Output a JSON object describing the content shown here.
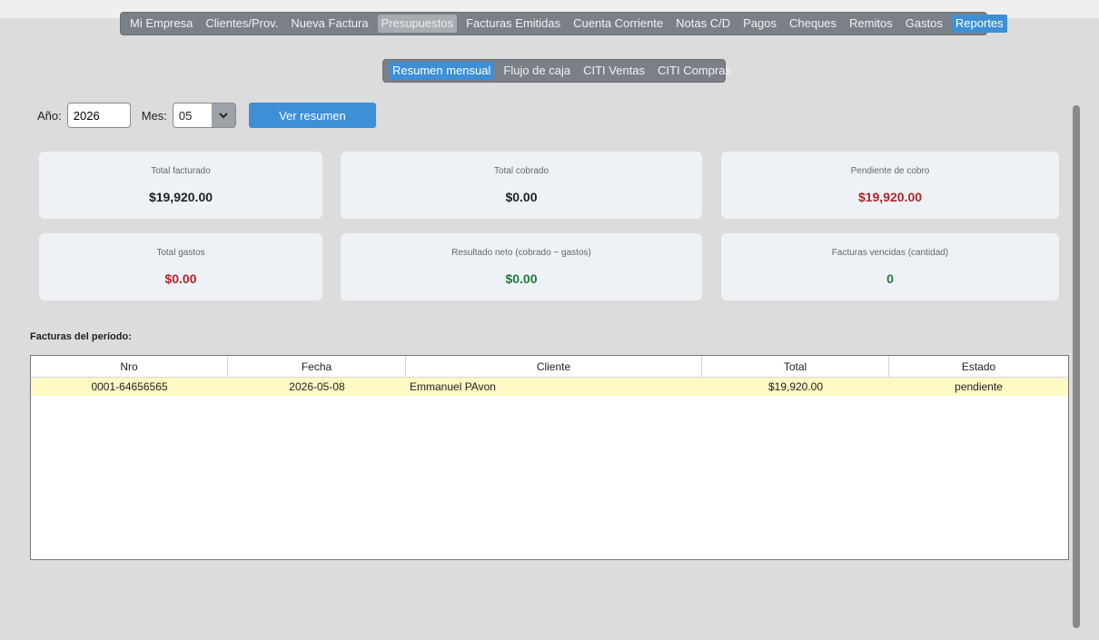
{
  "nav": {
    "tabs": [
      "Mi Empresa",
      "Clientes/Prov.",
      "Nueva Factura",
      "Presupuestos",
      "Facturas Emitidas",
      "Cuenta Corriente",
      "Notas C/D",
      "Pagos",
      "Cheques",
      "Remitos",
      "Gastos",
      "Reportes"
    ],
    "highlighted": "Presupuestos",
    "active": "Reportes"
  },
  "subnav": {
    "tabs": [
      "Resumen mensual",
      "Flujo de caja",
      "CITI Ventas",
      "CITI Compras"
    ],
    "active": "Resumen mensual"
  },
  "filters": {
    "year_label": "Año:",
    "year_value": "2026",
    "month_label": "Mes:",
    "month_value": "05",
    "submit_label": "Ver resumen"
  },
  "summary": {
    "total_facturado": {
      "label": "Total facturado",
      "value": "$19,920.00"
    },
    "total_cobrado": {
      "label": "Total cobrado",
      "value": "$0.00"
    },
    "pendiente_cobro": {
      "label": "Pendiente de cobro",
      "value": "$19,920.00"
    },
    "total_gastos": {
      "label": "Total gastos",
      "value": "$0.00"
    },
    "resultado_neto": {
      "label": "Resultado neto (cobrado − gastos)",
      "value": "$0.00"
    },
    "facturas_vencidas": {
      "label": "Facturas vencidas (cantidad)",
      "value": "0"
    }
  },
  "colors": {
    "accent": "#3d8fd6",
    "negative": "#b02428",
    "positive": "#1e7a3c",
    "row_highlight": "#fff9c4"
  },
  "invoices": {
    "title": "Facturas del período:",
    "columns": [
      "Nro",
      "Fecha",
      "Cliente",
      "Total",
      "Estado"
    ],
    "rows": [
      [
        "0001-64656565",
        "2026-05-08",
        "Emmanuel PAvon",
        "$19,920.00",
        "pendiente"
      ]
    ]
  }
}
